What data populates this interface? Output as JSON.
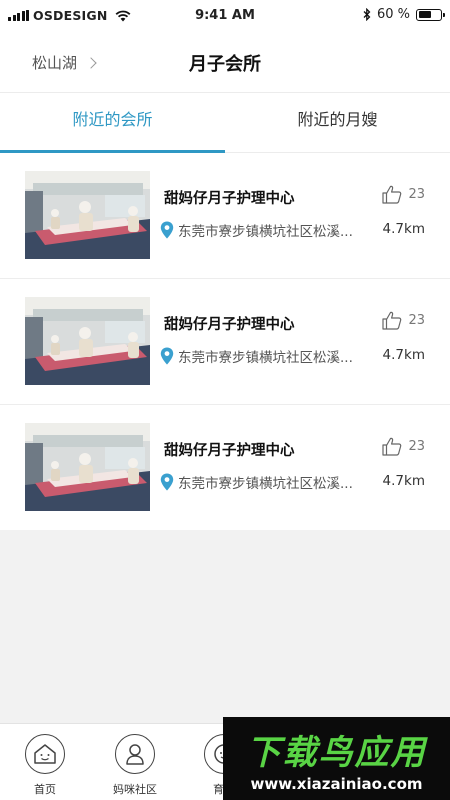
{
  "status_bar": {
    "carrier": "OSDESIGN",
    "time": "9:41 AM",
    "battery": "60 %",
    "battery_level": 0.6
  },
  "nav": {
    "location": "松山湖",
    "title": "月子会所"
  },
  "tabs": [
    {
      "label": "附近的会所",
      "active": true
    },
    {
      "label": "附近的月嫂",
      "active": false
    }
  ],
  "listings": [
    {
      "name": "甜妈仔月子护理中心",
      "likes": "23",
      "address": "东莞市寮步镇横坑社区松溪...",
      "distance": "4.7km"
    },
    {
      "name": "甜妈仔月子护理中心",
      "likes": "23",
      "address": "东莞市寮步镇横坑社区松溪...",
      "distance": "4.7km"
    },
    {
      "name": "甜妈仔月子护理中心",
      "likes": "23",
      "address": "东莞市寮步镇横坑社区松溪...",
      "distance": "4.7km"
    }
  ],
  "tabbar": [
    {
      "label": "首页",
      "icon": "home-smile-icon"
    },
    {
      "label": "妈咪社区",
      "icon": "person-icon"
    },
    {
      "label": "育儿",
      "icon": "baby-face-icon"
    }
  ],
  "watermark": {
    "title": "下载鸟应用",
    "url": "www.xiazainiao.com"
  },
  "colors": {
    "accent": "#2f98c4",
    "pin": "#3aa0cf",
    "watermark_green": "#59d445"
  }
}
